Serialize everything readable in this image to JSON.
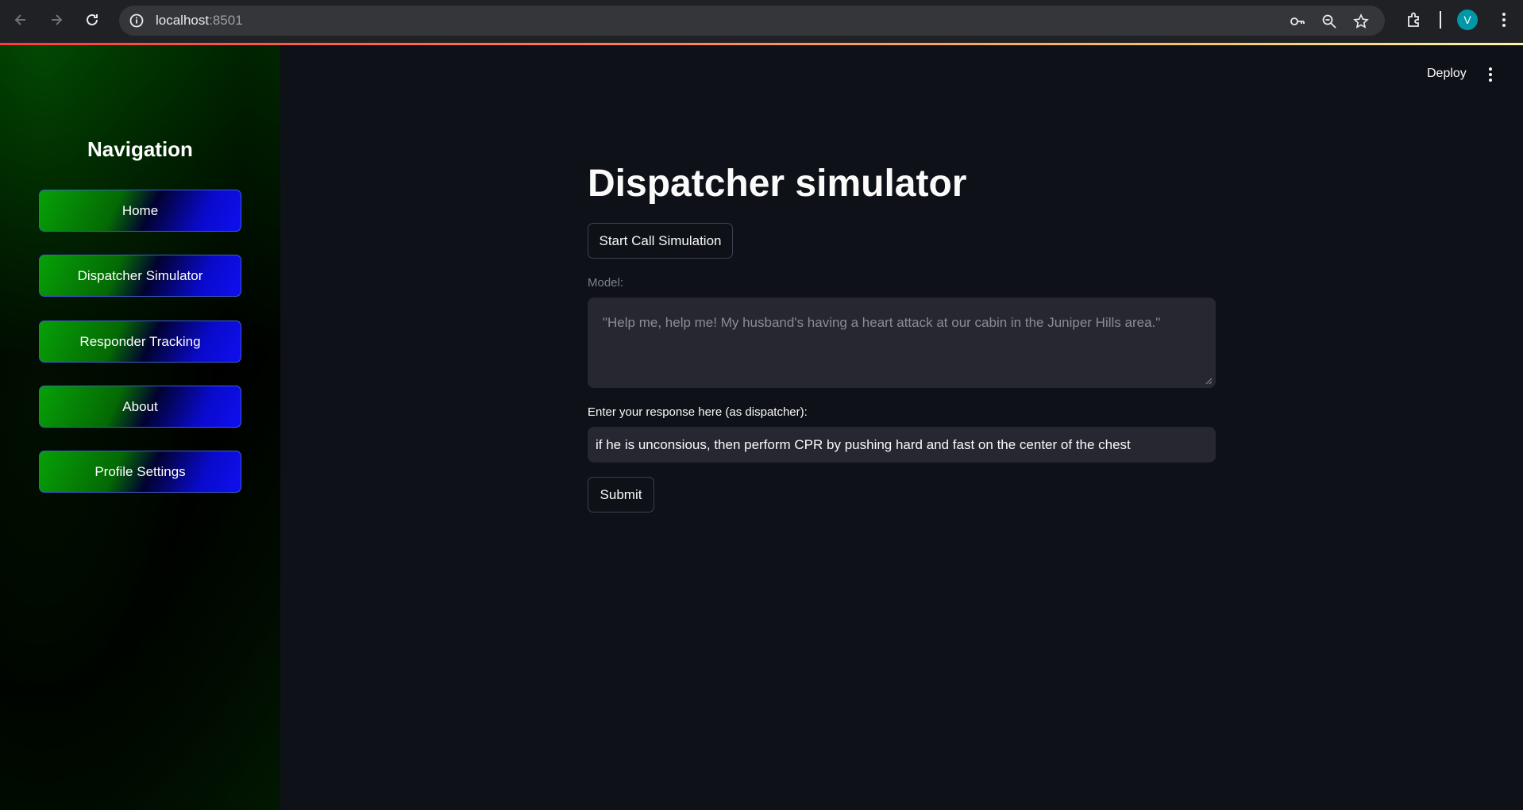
{
  "browser": {
    "url_host": "localhost",
    "url_port": ":8501",
    "profile_initial": "V",
    "icons": [
      "back-arrow-icon",
      "forward-arrow-icon",
      "reload-icon",
      "info-icon",
      "key-icon",
      "zoom-icon",
      "star-icon",
      "extensions-icon",
      "menu-dots-icon"
    ]
  },
  "app": {
    "deploy_label": "Deploy"
  },
  "sidebar": {
    "title": "Navigation",
    "items": [
      {
        "label": "Home"
      },
      {
        "label": "Dispatcher Simulator"
      },
      {
        "label": "Responder Tracking"
      },
      {
        "label": "About"
      },
      {
        "label": "Profile Settings"
      }
    ]
  },
  "main": {
    "title": "Dispatcher simulator",
    "start_button": "Start Call Simulation",
    "model_label": "Model:",
    "model_text": "\"Help me, help me! My husband's having a heart attack at our cabin in the Juniper Hills area.\"",
    "response_label": "Enter your response here (as dispatcher):",
    "response_value": "if he is unconsious, then perform CPR by pushing hard and fast on the center of the chest",
    "submit_button": "Submit"
  },
  "colors": {
    "background": "#0e1117",
    "chrome": "#202124",
    "input_bg": "#262730",
    "nav_green": "#07a007",
    "nav_blue": "#0f0ff0"
  }
}
